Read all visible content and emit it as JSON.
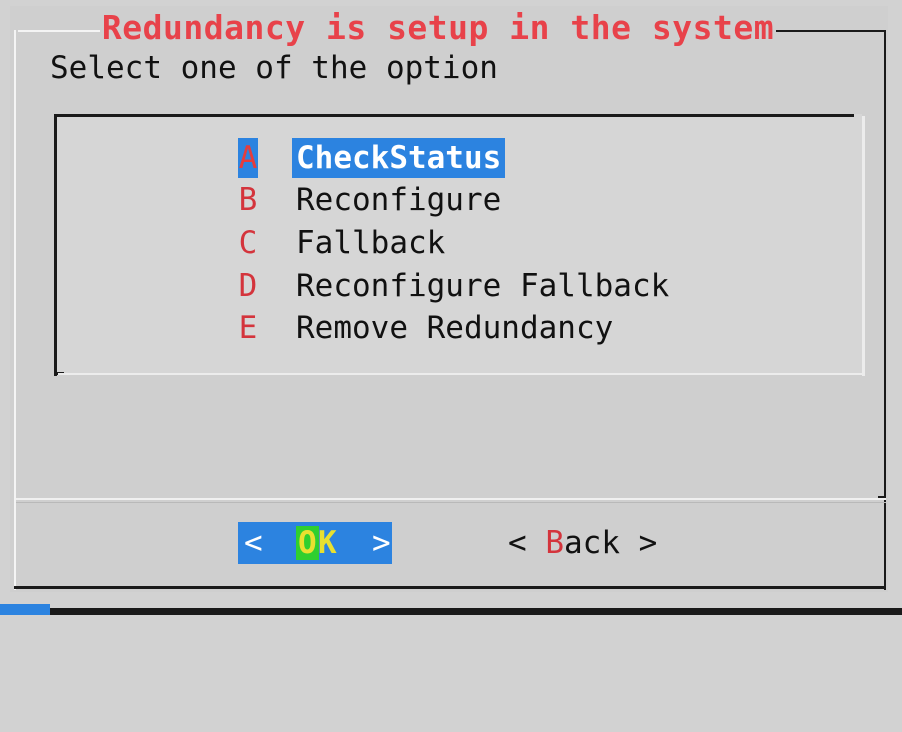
{
  "dialog": {
    "title": "Redundancy is setup in the system",
    "prompt": "Select one of the option"
  },
  "menu": {
    "items": [
      {
        "key": "A",
        "label": "CheckStatus",
        "selected": true
      },
      {
        "key": "B",
        "label": "Reconfigure",
        "selected": false
      },
      {
        "key": "C",
        "label": "Fallback",
        "selected": false
      },
      {
        "key": "D",
        "label": "Reconfigure Fallback",
        "selected": false
      },
      {
        "key": "E",
        "label": "Remove Redundancy",
        "selected": false
      }
    ]
  },
  "buttons": {
    "ok": {
      "left": "<",
      "hotkey": "O",
      "rest": "K",
      "right": ">"
    },
    "back": {
      "left": "< ",
      "hotkey": "B",
      "rest": "ack",
      "right": " >"
    }
  },
  "colors": {
    "accent": "#2c83e0",
    "title": "#e8424a",
    "hotkey": "#d4343c",
    "background": "#cfcfcf"
  }
}
